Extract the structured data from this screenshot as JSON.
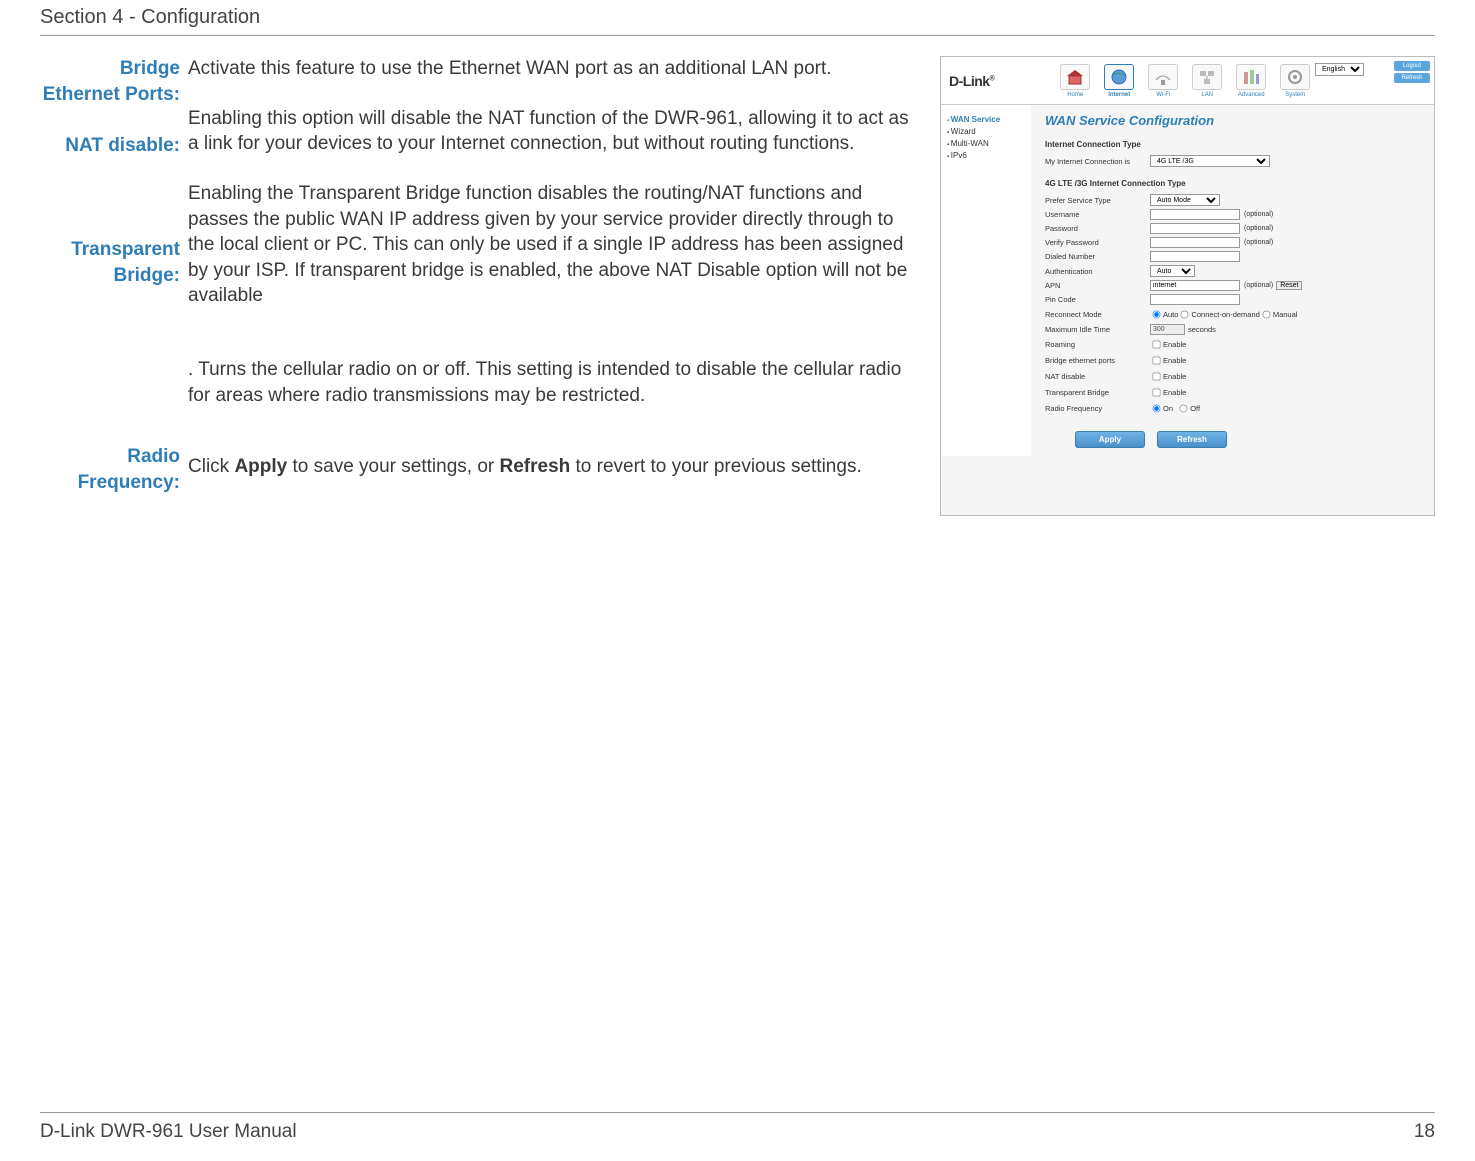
{
  "header": {
    "section": "Section 4 - Configuration"
  },
  "doc": {
    "labels": {
      "bridge": "Bridge Ethernet Ports:",
      "nat": "NAT disable:",
      "tbridge": "Transparent Bridge:",
      "radio": "Radio Frequency:"
    },
    "desc": {
      "bridge": "Activate this feature to use the Ethernet WAN port as an additional LAN port.",
      "nat": "Enabling this option will disable the NAT function of the DWR-961, allowing it to act as a link for your devices to your Internet connection, but without routing functions.",
      "tbridge": "Enabling the Transparent Bridge function disables the routing/NAT functions and passes the public WAN IP address given by your service provider directly through to the local client or PC. This can only be used if a single IP address has been assigned by your ISP. If transparent bridge is enabled, the above NAT Disable option will not be available",
      "radio": ". Turns the cellular radio on or off. This setting is intended to disable the cellular radio for areas where radio transmissions may be restricted.",
      "apply_pre": "Click ",
      "apply_b1": "Apply",
      "apply_mid": " to save your settings, or ",
      "apply_b2": "Refresh",
      "apply_post": " to revert to your previous settings."
    }
  },
  "ui": {
    "logo": "D-Link",
    "nav": [
      "Home",
      "Internet",
      "Wi-Fi",
      "LAN",
      "Advanced",
      "System"
    ],
    "lang": "English",
    "topbtns": {
      "logout": "Logout",
      "refresh": "Refresh"
    },
    "side": [
      "WAN Service",
      "Wizard",
      "Multi-WAN",
      "IPv6"
    ],
    "panel_title": "WAN Service Configuration",
    "sec1": "Internet Connection Type",
    "conn_label": "My Internet Connection is",
    "conn_value": "4G LTE /3G",
    "sec2": "4G LTE /3G Internet Connection Type",
    "fields": {
      "prefer": {
        "label": "Prefer Service Type",
        "value": "Auto Mode"
      },
      "username": {
        "label": "Username",
        "optional": "(optional)"
      },
      "password": {
        "label": "Password",
        "optional": "(optional)"
      },
      "verify": {
        "label": "Verify Password",
        "optional": "(optional)"
      },
      "dialed": {
        "label": "Dialed Number"
      },
      "auth": {
        "label": "Authentication",
        "value": "Auto"
      },
      "apn": {
        "label": "APN",
        "value": "internet",
        "optional": "(optional)",
        "reset": "Reset"
      },
      "pin": {
        "label": "Pin Code"
      },
      "reconnect": {
        "label": "Reconnect Mode",
        "opts": [
          "Auto",
          "Connect-on-demand",
          "Manual"
        ]
      },
      "idle": {
        "label": "Maximum Idle Time",
        "value": "300",
        "unit": "seconds"
      },
      "roaming": {
        "label": "Roaming",
        "opt": "Enable"
      },
      "bep": {
        "label": "Bridge ethernet ports",
        "opt": "Enable"
      },
      "natd": {
        "label": "NAT disable",
        "opt": "Enable"
      },
      "tbr": {
        "label": "Transparent Bridge",
        "opt": "Enable"
      },
      "rf": {
        "label": "Radio Frequency",
        "on": "On",
        "off": "Off"
      }
    },
    "buttons": {
      "apply": "Apply",
      "refresh": "Refresh"
    }
  },
  "footer": {
    "left": "D-Link DWR-961 User Manual",
    "page": "18"
  }
}
